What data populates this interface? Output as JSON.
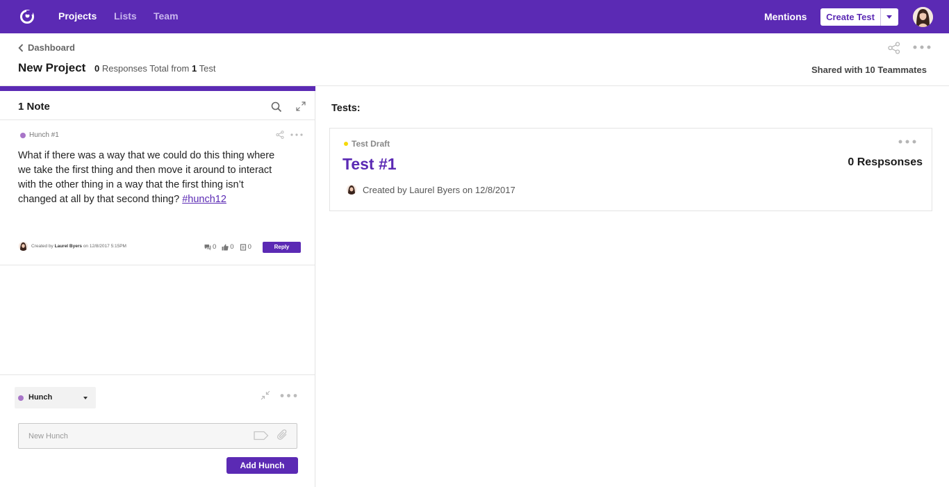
{
  "nav": {
    "items": [
      {
        "label": "Projects",
        "active": true
      },
      {
        "label": "Lists",
        "active": false
      },
      {
        "label": "Team",
        "active": false
      }
    ],
    "mentions_label": "Mentions",
    "create_label": "Create Test"
  },
  "header": {
    "breadcrumb": "Dashboard",
    "project_title": "New Project",
    "responses_count": "0",
    "responses_text": "Responses Total from",
    "tests_count": "1",
    "tests_text": "Test",
    "shared_with": "Shared with 10 Teammates"
  },
  "notes": {
    "title": "1 Note",
    "items": [
      {
        "tag": "Hunch #1",
        "body": "What if there was a way that we could do this thing where we take the first thing and then move it around to interact with the other thing in a way that the first thing isn’t changed at all by that second thing?",
        "hashtag": "#hunch12",
        "created_prefix": "Created by",
        "author": "Laurel Byers",
        "created_suffix": "on 12/8/2017 5:15PM",
        "comments": "0",
        "likes": "0",
        "attachments": "0",
        "reply_label": "Reply"
      }
    ]
  },
  "composer": {
    "type_label": "Hunch",
    "placeholder": "New Hunch",
    "submit_label": "Add Hunch"
  },
  "tests": {
    "title": "Tests:",
    "items": [
      {
        "status": "Test Draft",
        "name": "Test #1",
        "responses": "0 Respsonses",
        "created": "Created by Laurel Byers on 12/8/2017"
      }
    ]
  },
  "colors": {
    "brand": "#5b2ab4",
    "hunch_dot": "#a875c8",
    "draft_dot": "#f5d90a"
  },
  "icons": [
    "logo-icon",
    "search-icon",
    "expand-icon",
    "share-icon",
    "more-icon",
    "collapse-icon",
    "tag-icon",
    "paperclip-icon",
    "comment-icon",
    "thumbs-up-icon",
    "attachment-icon",
    "chevron-left-icon"
  ]
}
